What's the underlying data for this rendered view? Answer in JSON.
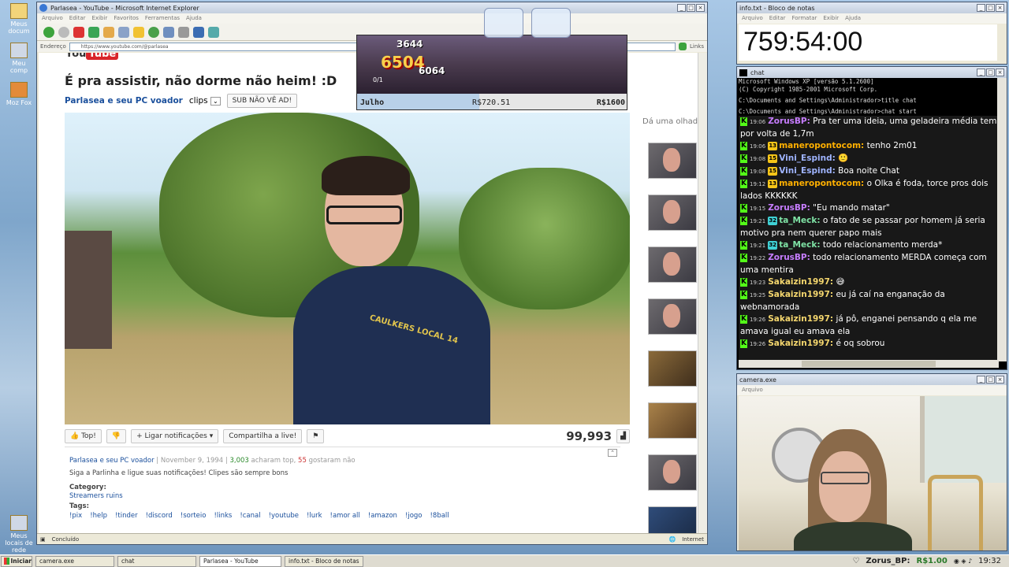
{
  "desktop": {
    "icons": [
      "Meus docum",
      "Meu comp",
      "Moz Fox",
      "Meus locais de rede"
    ]
  },
  "ie": {
    "title": "Parlasea - YouTube - Microsoft Internet Explorer",
    "menu": [
      "Arquivo",
      "Editar",
      "Exibir",
      "Favoritos",
      "Ferramentas",
      "Ajuda"
    ],
    "address_label": "Endereço",
    "address_url": "https://www.youtube.com/@parlasea",
    "links_label": "Links",
    "status_left": "Concluído",
    "status_zone": "Internet"
  },
  "youtube": {
    "logo_prefix": "You",
    "logo_box": "Tube",
    "video_title": "É pra assistir, não dorme não heim! :D",
    "channel_name": "Parlasea e seu PC voador",
    "clips_label": "clips",
    "subscribe_label": "SUB NÃO VÊ AD!",
    "like_label": "Top!",
    "notify_label": "Ligar notificações",
    "share_label": "Compartilha a live!",
    "views": "99,993",
    "sidebar_heading": "Dá uma olhada",
    "shirt_text": "CAULKERS LOCAL 14",
    "desc_channel": "Parlasea e seu PC voador",
    "desc_date": "November 9, 1994",
    "desc_likes": "3,003",
    "desc_likes_text": "acharam top,",
    "desc_dislikes": "55",
    "desc_dislikes_text": "gostaram não",
    "desc_text": "Siga a Parlinha e ligue suas notificações! Clipes são sempre bons",
    "category_label": "Category:",
    "category_value": "Streamers ruins",
    "tags_label": "Tags:",
    "tags": [
      "!pix",
      "!help",
      "!tinder",
      "!discord",
      "!sorteio",
      "!links",
      "!canal",
      "!youtube",
      "!lurk",
      "!amor all",
      "!amazon",
      "!jogo",
      "!8ball"
    ]
  },
  "game": {
    "score": "6504",
    "score_top": "3644",
    "sub_score": "6064",
    "count": "0/1",
    "month": "Julho",
    "current": "R$720.51",
    "goal": "R$1600",
    "progress_fraction": 0.45
  },
  "notepad": {
    "title": "info.txt - Bloco de notas",
    "menu": [
      "Arquivo",
      "Editar",
      "Formatar",
      "Exibir",
      "Ajuda"
    ],
    "content": "759:54:00"
  },
  "chat": {
    "title": "chat",
    "cmd_lines": [
      "Microsoft Windows XP [versão 5.1.2600]",
      "(C) Copyright 1985-2001 Microsoft Corp.",
      "",
      "C:\\Documents and Settings\\Administrador>title chat",
      "",
      "C:\\Documents and Settings\\Administrador>chat start"
    ],
    "messages": [
      {
        "time": "19:06",
        "badge": "",
        "user": "ZorusBP:",
        "color": "#c77dff",
        "text": "Pra ter uma ideia, uma geladeira média tem por volta de 1,7m"
      },
      {
        "time": "19:06",
        "badge": "13",
        "user": "maneropontocom:",
        "color": "#ffb000",
        "text": "tenho 2m01"
      },
      {
        "time": "19:08",
        "badge": "15",
        "user": "Vini_Espind:",
        "color": "#9fb4ff",
        "text": "🙂"
      },
      {
        "time": "19:08",
        "badge": "15",
        "user": "Vini_Espind:",
        "color": "#9fb4ff",
        "text": "Boa noite Chat"
      },
      {
        "time": "19:12",
        "badge": "13",
        "user": "maneropontocom:",
        "color": "#ffb000",
        "text": "o Olka é foda, torce pros dois lados KKKKKK"
      },
      {
        "time": "19:15",
        "badge": "",
        "user": "ZorusBP:",
        "color": "#c77dff",
        "text": "\"Eu mando matar\""
      },
      {
        "time": "19:21",
        "badge": "32",
        "user": "ta_Meck:",
        "color": "#7fe3a5",
        "text": "o fato de se passar por homem já seria motivo pra nem querer papo mais"
      },
      {
        "time": "19:21",
        "badge": "32",
        "user": "ta_Meck:",
        "color": "#7fe3a5",
        "text": "todo relacionamento merda*"
      },
      {
        "time": "19:22",
        "badge": "",
        "user": "ZorusBP:",
        "color": "#c77dff",
        "text": "todo relacionamento MERDA começa com uma mentira"
      },
      {
        "time": "19:23",
        "badge": "",
        "user": "Sakaizin1997:",
        "color": "#f5d76e",
        "text": "😅"
      },
      {
        "time": "19:25",
        "badge": "",
        "user": "Sakaizin1997:",
        "color": "#f5d76e",
        "text": "eu já caí na enganação da webnamorada"
      },
      {
        "time": "19:26",
        "badge": "",
        "user": "Sakaizin1997:",
        "color": "#f5d76e",
        "text": "já pô, enganei pensando q ela me amava igual eu amava ela"
      },
      {
        "time": "19:26",
        "badge": "",
        "user": "Sakaizin1997:",
        "color": "#f5d76e",
        "text": "é oq sobrou"
      }
    ]
  },
  "camera": {
    "title": "camera.exe",
    "menu": "Arquivo"
  },
  "taskbar": {
    "start": "Iniciar",
    "tasks": [
      "camera.exe",
      "chat",
      "Parlasea - YouTube",
      "info.txt - Bloco de notas"
    ],
    "donor": "Zorus_BP:",
    "amount": "R$1.00",
    "clock": "19:32"
  }
}
